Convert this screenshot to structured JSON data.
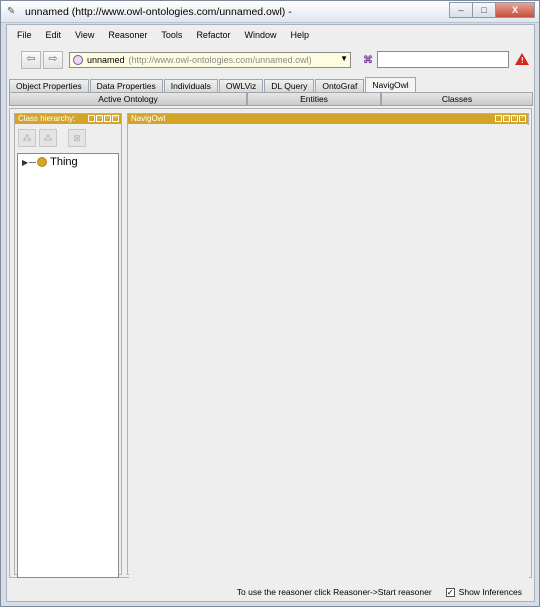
{
  "window": {
    "title": "unnamed (http://www.owl-ontologies.com/unnamed.owl) -",
    "controls": {
      "minimize": "–",
      "maximize": "□",
      "close": "X"
    }
  },
  "menu": [
    "File",
    "Edit",
    "View",
    "Reasoner",
    "Tools",
    "Refactor",
    "Window",
    "Help"
  ],
  "toolbar": {
    "back_icon": "arrow-left-icon",
    "forward_icon": "arrow-right-icon",
    "ontology_name": "unnamed",
    "ontology_uri": "(http://www.owl-ontologies.com/unnamed.owl)",
    "search_value": ""
  },
  "tabs": [
    "Object Properties",
    "Data Properties",
    "Individuals",
    "OWLViz",
    "DL Query",
    "OntoGraf",
    "NavigOwl"
  ],
  "active_tab": "NavigOwl",
  "subtabs": [
    "Active Ontology",
    "Entities",
    "Classes"
  ],
  "class_hierarchy": {
    "title": "Class hierarchy:",
    "root": "Thing"
  },
  "navigowl_panel": {
    "title": "NavigOwl"
  },
  "statusbar": {
    "message": "To use the reasoner click Reasoner->Start reasoner",
    "show_inferences_label": "Show Inferences",
    "show_inferences_checked": true
  },
  "colors": {
    "panel_header": "#d4a428",
    "warning": "#d8241f"
  }
}
